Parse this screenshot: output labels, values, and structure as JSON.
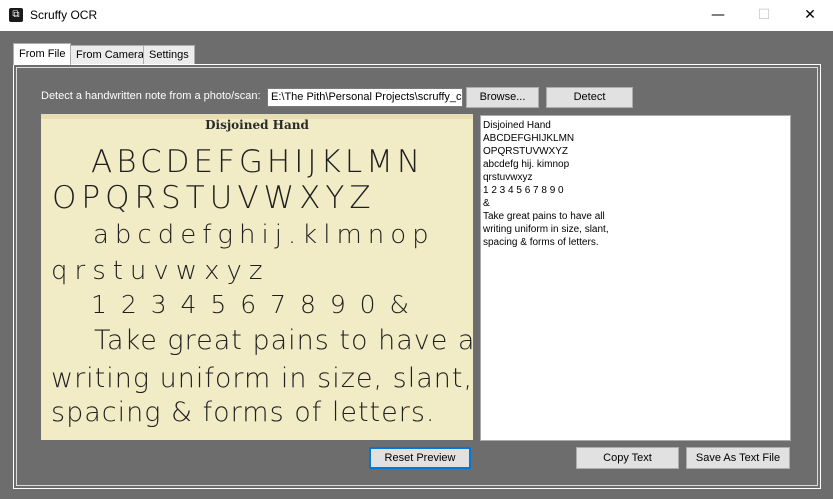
{
  "window": {
    "title": "Scruffy OCR",
    "minimize": "—",
    "maximize": "☐",
    "close": "✕"
  },
  "tabs": [
    "From File",
    "From Camera",
    "Settings"
  ],
  "from_file": {
    "prompt": "Detect a handwritten note from a photo/scan:",
    "path_value": "E:\\The Pith\\Personal Projects\\scruffy_c",
    "browse_label": "Browse...",
    "detect_label": "Detect",
    "reset_preview_label": "Reset Preview",
    "copy_text_label": "Copy Text",
    "save_text_label": "Save As Text File"
  },
  "preview_note": {
    "title": "Disjoined Hand",
    "lines": [
      "ABCDEFGHIJKLMN",
      "OPQRSTUVWXYZ",
      "abcdefghij.klmnop",
      "qrstuvwxyz",
      "1 2 3 4 5 6 7 8 9 0   &",
      "Take great pains to have all",
      "writing uniform in size, slant,",
      "spacing & forms of letters."
    ]
  },
  "ocr_output": {
    "lines": [
      "Disjoined Hand",
      "ABCDEFGHIJKLMN",
      "OPQRSTUVWXYZ",
      "abcdefg hij. kimnop",
      "qrstuvwxyz",
      "1 2 3 4 5 6 7 8 9 0",
      "&",
      "Take great pains to have all",
      "writing uniform in size, slant,",
      "spacing & forms of letters."
    ]
  },
  "colors": {
    "window_bg": "#6d6d6d",
    "focus_accent": "#0078d7",
    "paper": "#f1ebc6"
  }
}
